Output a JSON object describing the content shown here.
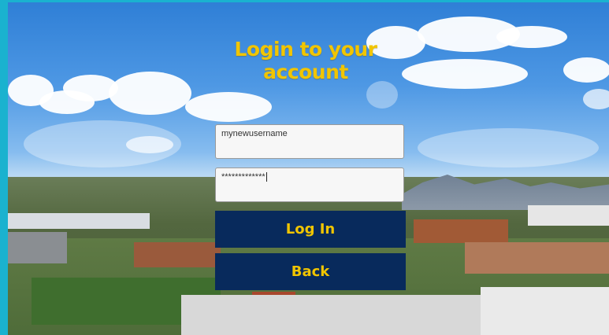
{
  "page": {
    "title": "Login to your account"
  },
  "form": {
    "username_value": "mynewusername",
    "password_value": "*************",
    "login_label": "Log In",
    "back_label": "Back"
  },
  "colors": {
    "frame": "#1ab2cf",
    "title_text": "#f1c500",
    "button_bg": "#082a5c",
    "button_text": "#f1c500"
  }
}
